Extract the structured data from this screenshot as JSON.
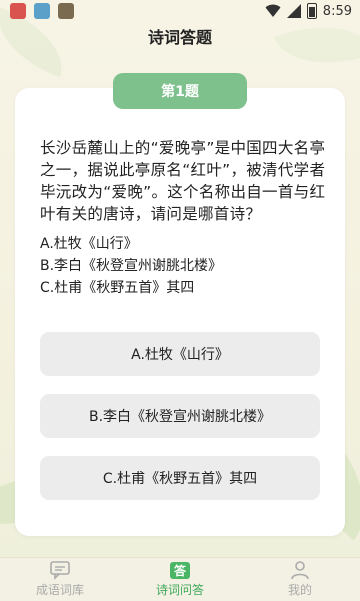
{
  "status": {
    "time": "8:59"
  },
  "header": {
    "title": "诗词答题"
  },
  "quiz": {
    "badge": "第1题",
    "question": "长沙岳麓山上的“爱晚亭”是中国四大名亭之一，据说此亭原名“红叶”，被清代学者毕沅改为“爱晚”。这个名称出自一首与红叶有关的唐诗，请问是哪首诗？",
    "options_text": [
      "A.杜牧《山行》",
      "B.李白《秋登宣州谢朓北楼》",
      "C.杜甫《秋野五首》其四"
    ],
    "buttons": [
      "A.杜牧《山行》",
      "B.李白《秋登宣州谢朓北楼》",
      "C.杜甫《秋野五首》其四"
    ]
  },
  "nav": {
    "items": [
      {
        "label": "成语词库",
        "icon": "chat-icon"
      },
      {
        "label": "诗词问答",
        "icon": "answer-icon",
        "icon_text": "答"
      },
      {
        "label": "我的",
        "icon": "user-icon"
      }
    ]
  },
  "colors": {
    "accent": "#7ec18c",
    "nav_active": "#3ea85a",
    "button_bg": "#ececec"
  }
}
